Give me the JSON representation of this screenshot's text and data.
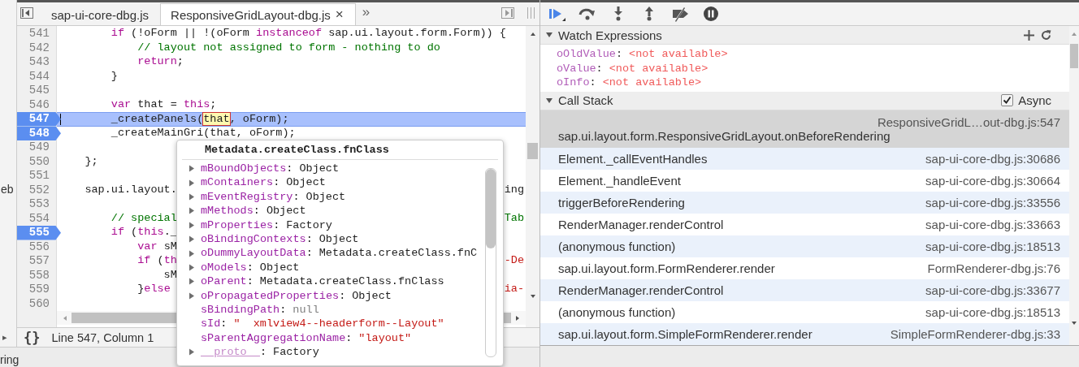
{
  "left_strip": {
    "label": "eb",
    "expand_arrow": "▸"
  },
  "status_text": "ring",
  "tabs": [
    {
      "label": "sap-ui-core-dbg.js",
      "selected": false
    },
    {
      "label": "ResponsiveGridLayout-dbg.js",
      "selected": true,
      "close": "×"
    }
  ],
  "tab_overflow": "»",
  "code_lines": [
    {
      "number": "541",
      "breakpoint": false,
      "current": false,
      "tokens": [
        {
          "text": "        if",
          "kind": "keyword"
        },
        {
          "text": " (!oForm || !(oForm ",
          "kind": "plain"
        },
        {
          "text": "instanceof",
          "kind": "keyword"
        },
        {
          "text": " sap.ui.layout.form.Form)) {",
          "kind": "plain"
        }
      ]
    },
    {
      "number": "542",
      "breakpoint": false,
      "current": false,
      "tokens": [
        {
          "text": "            // layout not assigned to form - nothing to do",
          "kind": "comment"
        }
      ]
    },
    {
      "number": "543",
      "breakpoint": false,
      "current": false,
      "tokens": [
        {
          "text": "            return",
          "kind": "keyword"
        },
        {
          "text": ";",
          "kind": "plain"
        }
      ]
    },
    {
      "number": "544",
      "breakpoint": false,
      "current": false,
      "tokens": [
        {
          "text": "        }",
          "kind": "plain"
        }
      ]
    },
    {
      "number": "545",
      "breakpoint": false,
      "current": false
    },
    {
      "number": "546",
      "breakpoint": false,
      "current": false,
      "tokens": [
        {
          "text": "        var",
          "kind": "keyword"
        },
        {
          "text": " that = ",
          "kind": "plain"
        },
        {
          "text": "this",
          "kind": "keyword"
        },
        {
          "text": ";",
          "kind": "plain"
        }
      ]
    },
    {
      "number": "547",
      "breakpoint": true,
      "current": true,
      "tokens": [
        {
          "text": "        _createPanels(",
          "kind": "plain"
        },
        {
          "text": "that",
          "kind": "hover"
        },
        {
          "text": ", oForm);",
          "kind": "plain"
        }
      ]
    },
    {
      "number": "548",
      "breakpoint": true,
      "current": false,
      "tokens": [
        {
          "text": "        _createMainGri",
          "kind": "plain"
        },
        {
          "text": "(that, oForm);",
          "kind": "plain"
        }
      ]
    },
    {
      "number": "549",
      "breakpoint": false,
      "current": false
    },
    {
      "number": "550",
      "breakpoint": false,
      "current": false,
      "tokens": [
        {
          "text": "    };",
          "kind": "plain"
        }
      ]
    },
    {
      "number": "551",
      "breakpoint": false,
      "current": false
    },
    {
      "number": "552",
      "breakpoint": false,
      "current": false,
      "tokens": [
        {
          "text": "    sap.ui.layout.",
          "kind": "plain"
        }
      ],
      "tail": {
        "text": "ing",
        "kind": "plain"
      }
    },
    {
      "number": "553",
      "breakpoint": false,
      "current": false
    },
    {
      "number": "554",
      "breakpoint": false,
      "current": false,
      "tokens": [
        {
          "text": "        // special",
          "kind": "comment"
        }
      ],
      "tail": {
        "text": "Tab",
        "kind": "comment"
      }
    },
    {
      "number": "555",
      "breakpoint": true,
      "current": false,
      "tokens": [
        {
          "text": "        if",
          "kind": "keyword"
        },
        {
          "text": " (",
          "kind": "plain"
        },
        {
          "text": "this",
          "kind": "keyword"
        },
        {
          "text": "._",
          "kind": "plain"
        }
      ]
    },
    {
      "number": "556",
      "breakpoint": false,
      "current": false,
      "tokens": [
        {
          "text": "            var",
          "kind": "keyword"
        },
        {
          "text": " sM",
          "kind": "plain"
        }
      ]
    },
    {
      "number": "557",
      "breakpoint": false,
      "current": false,
      "tokens": [
        {
          "text": "            if",
          "kind": "keyword"
        },
        {
          "text": " (",
          "kind": "plain"
        },
        {
          "text": "th",
          "kind": "keyword"
        }
      ],
      "tail": {
        "text": "-De",
        "kind": "string"
      }
    },
    {
      "number": "558",
      "breakpoint": false,
      "current": false,
      "tokens": [
        {
          "text": "                sM",
          "kind": "plain"
        }
      ]
    },
    {
      "number": "559",
      "breakpoint": false,
      "current": false,
      "tokens": [
        {
          "text": "            }",
          "kind": "plain"
        },
        {
          "text": "else",
          "kind": "keyword"
        }
      ],
      "tail": {
        "text": "ia-",
        "kind": "string"
      }
    },
    {
      "number": "560",
      "breakpoint": false,
      "current": false
    }
  ],
  "cursor": {
    "position": "Line 547, Column 1",
    "format_button": "{}"
  },
  "popover": {
    "title": "Metadata.createClass.fnClass",
    "properties": [
      {
        "name": "mBoundObjects",
        "separator": ":",
        "value": "Object",
        "expandable": true,
        "internal": false
      },
      {
        "name": "mContainers",
        "separator": ":",
        "value": "Object",
        "expandable": true,
        "internal": false
      },
      {
        "name": "mEventRegistry",
        "separator": ":",
        "value": "Object",
        "expandable": true,
        "internal": false
      },
      {
        "name": "mMethods",
        "separator": ":",
        "value": "Object",
        "expandable": true,
        "internal": false
      },
      {
        "name": "mProperties",
        "separator": ":",
        "value": "Factory",
        "expandable": true,
        "internal": false
      },
      {
        "name": "oBindingContexts",
        "separator": ":",
        "value": "Object",
        "expandable": true,
        "internal": false
      },
      {
        "name": "oDummyLayoutData",
        "separator": ":",
        "value": "Metadata.createClass.fnC",
        "expandable": true,
        "internal": false
      },
      {
        "name": "oModels",
        "separator": ":",
        "value": "Object",
        "expandable": true,
        "internal": false
      },
      {
        "name": "oParent",
        "separator": ":",
        "value": "Metadata.createClass.fnClass",
        "expandable": true,
        "internal": false
      },
      {
        "name": "oPropagatedProperties",
        "separator": ":",
        "value": "Object",
        "expandable": true,
        "internal": false
      },
      {
        "name": "sBindingPath",
        "separator": ":",
        "value": "null",
        "kind": "null",
        "expandable": false,
        "internal": false
      },
      {
        "name": "sId",
        "separator": ":",
        "value": "\"  xmlview4--headerform--Layout\"",
        "kind": "string",
        "expandable": false,
        "internal": false
      },
      {
        "name": "sParentAggregationName",
        "separator": ":",
        "value": "\"layout\"",
        "kind": "string",
        "expandable": false,
        "internal": false
      },
      {
        "name": "__proto__",
        "separator": ":",
        "value": "Factory",
        "expandable": true,
        "internal": true
      }
    ]
  },
  "debug_toolbar": [
    {
      "kind": "resume",
      "active": true
    },
    {
      "kind": "step-over",
      "active": false
    },
    {
      "kind": "step-into",
      "active": false
    },
    {
      "kind": "step-out",
      "active": false
    },
    {
      "kind": "deactivate-breakpoints",
      "active": false
    },
    {
      "kind": "pause-on-exceptions",
      "active": false
    }
  ],
  "watch_expressions": {
    "title": "Watch Expressions",
    "expanded": true,
    "items": [
      {
        "name": "oOldValue",
        "separator": ":",
        "value": "<not available>"
      },
      {
        "name": "oValue",
        "separator": ":",
        "value": "<not available>"
      },
      {
        "name": "oInfo",
        "separator": ":",
        "value": "<not available>"
      }
    ]
  },
  "call_stack": {
    "title": "Call Stack",
    "expanded": true,
    "async_label": "Async",
    "async": true,
    "frames": [
      {
        "function": "sap.ui.layout.form.ResponsiveGridLayout.onBeforeRendering",
        "location": "ResponsiveGridL…out-dbg.js:547",
        "selected": true
      },
      {
        "function": "Element._callEventHandles",
        "location": "sap-ui-core-dbg.js:30686",
        "selected": false
      },
      {
        "function": "Element._handleEvent",
        "location": "sap-ui-core-dbg.js:30664",
        "selected": false
      },
      {
        "function": "triggerBeforeRendering",
        "location": "sap-ui-core-dbg.js:33556",
        "selected": false
      },
      {
        "function": "RenderManager.renderControl",
        "location": "sap-ui-core-dbg.js:33663",
        "selected": false
      },
      {
        "function": "(anonymous function)",
        "location": "sap-ui-core-dbg.js:18513",
        "selected": false
      },
      {
        "function": "sap.ui.layout.form.FormRenderer.render",
        "location": "FormRenderer-dbg.js:76",
        "selected": false
      },
      {
        "function": "RenderManager.renderControl",
        "location": "sap-ui-core-dbg.js:33677",
        "selected": false
      },
      {
        "function": "(anonymous function)",
        "location": "sap-ui-core-dbg.js:18513",
        "selected": false
      },
      {
        "function": "sap.ui.layout.form.SimpleFormRenderer.render",
        "location": "SimpleFormRenderer-dbg.js:33",
        "selected": false
      }
    ]
  }
}
